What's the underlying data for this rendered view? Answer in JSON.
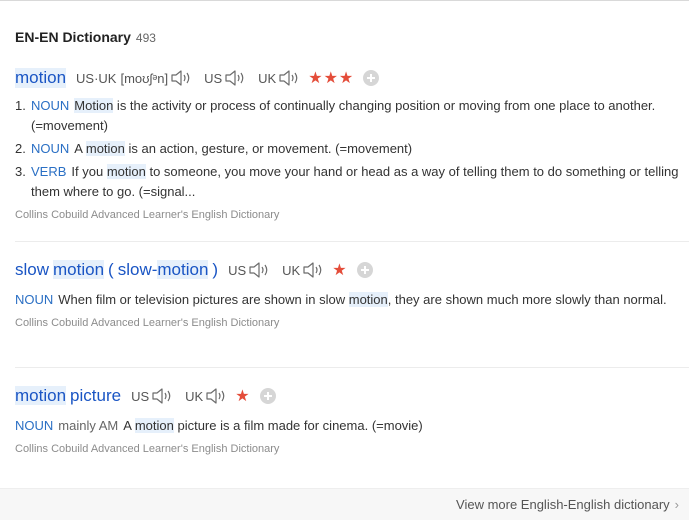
{
  "section": {
    "title": "EN-EN Dictionary",
    "count": "493"
  },
  "entries": [
    {
      "headword_parts": [
        "motion"
      ],
      "pronunciations": [
        {
          "label": "US·UK",
          "phonetic": "[moʊʃᵊn]"
        },
        {
          "label": "US"
        },
        {
          "label": "UK"
        }
      ],
      "stars": "★★★",
      "senses": [
        {
          "num": "1.",
          "pos": "NOUN",
          "pre": "",
          "hl": "Motion",
          "post": " is the activity or process of continually changing position or moving from one place to another. (=movement)"
        },
        {
          "num": "2.",
          "pos": "NOUN",
          "pre": "A ",
          "hl": "motion",
          "post": " is an action, gesture, or movement. (=movement)"
        },
        {
          "num": "3.",
          "pos": "VERB",
          "pre": "If you ",
          "hl": "motion",
          "post": " to someone, you move your hand or head as a way of telling them to do something or telling them where to go. (=signal..."
        }
      ],
      "source": "Collins Cobuild Advanced Learner's English Dictionary"
    },
    {
      "headword_parts": [
        "slow",
        "motion",
        "(",
        "slow-",
        "motion",
        ")"
      ],
      "pronunciations": [
        {
          "label": "US"
        },
        {
          "label": "UK"
        }
      ],
      "stars": "★",
      "definition": {
        "pos": "NOUN",
        "pre": "When film or television pictures are shown in slow ",
        "hl": "motion",
        "post": ", they are shown much more slowly than normal."
      },
      "source": "Collins Cobuild Advanced Learner's English Dictionary"
    },
    {
      "headword_parts": [
        "motion",
        "picture"
      ],
      "pronunciations": [
        {
          "label": "US"
        },
        {
          "label": "UK"
        }
      ],
      "stars": "★",
      "senses": [
        {
          "num": "",
          "pos": "NOUN",
          "register": "mainly AM",
          "pre": "A ",
          "hl": "motion",
          "post": " picture is a film made for cinema. (=movie)"
        }
      ],
      "source": "Collins Cobuild Advanced Learner's English Dictionary"
    }
  ],
  "footer": {
    "more_link": "View more English-English dictionary",
    "chevron": "›"
  },
  "icons": {
    "speaker": "speaker-icon",
    "add": "plus-circle-icon"
  },
  "colors": {
    "headword": "#1a55c4",
    "pos": "#2a6fc4",
    "star": "#e44d3a",
    "highlight": "#e6f0fb"
  }
}
